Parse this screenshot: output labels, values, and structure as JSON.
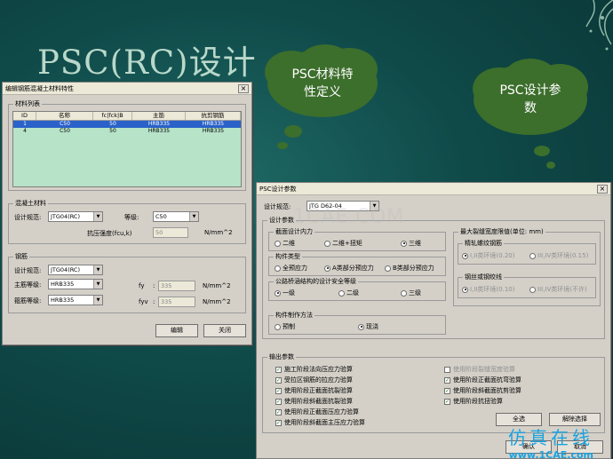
{
  "slide": {
    "title": "PSC(RC)设计"
  },
  "clouds": {
    "material": [
      "PSC材料特",
      "性定义"
    ],
    "design": [
      "PSC设计参",
      "数"
    ]
  },
  "material_dialog": {
    "title": "编辑钢筋混凝土材料特性",
    "close": "×",
    "list_group": "材料列表",
    "columns": [
      "ID",
      "名称",
      "fc|fck|B",
      "主筋",
      "抗剪钢筋"
    ],
    "rows": [
      [
        "1",
        "C50",
        "50",
        "HRB335",
        "HRB335"
      ],
      [
        "4",
        "C50",
        "50",
        "HRB335",
        "HRB335"
      ]
    ],
    "concrete_group": "混凝土材料",
    "design_code_label": "设计规范:",
    "design_code_value": "JTG04(RC)",
    "grade_label": "等级:",
    "grade_value": "C50",
    "strength_label": "抗压强度(fcu,k)",
    "strength_value": "50",
    "strength_unit": "N/mm^2",
    "rebar_group": "钢筋",
    "rebar_code_label": "设计规范:",
    "rebar_code_value": "JTG04(RC)",
    "main_label": "主筋等级:",
    "main_value": "HRB335",
    "stirrup_label": "箍筋等级:",
    "stirrup_value": "HRB335",
    "fy_label": "fy",
    "fy_value": "335",
    "fy_unit": "N/mm^2",
    "fyv_label": "fyv",
    "fyv_value": "335",
    "fyv_unit": "N/mm^2",
    "edit_btn": "编辑",
    "close_btn": "关闭"
  },
  "design_dialog": {
    "title": "PSC设计参数",
    "close": "×",
    "code_label": "设计规范:",
    "code_value": "JTG D62-04",
    "design_params": "设计参数",
    "internal_force": "截面设计内力",
    "force_opts": [
      "二维",
      "二维+扭矩",
      "三维"
    ],
    "member_type": "构件类型",
    "type_opts": [
      "全预应力",
      "A类部分预应力",
      "B类部分预应力"
    ],
    "safety_level": "公路桥涵结构的设计安全等级",
    "safety_opts": [
      "一级",
      "二级",
      "三级"
    ],
    "method": "构件制作方法",
    "method_opts": [
      "预制",
      "现浇"
    ],
    "crack_group": "最大裂缝宽度限值(单位: mm)",
    "rebar_group": "精轧螺纹钢筋",
    "rebar_opts": [
      "I,II类环境(0.20)",
      "III,IV类环境(0.15)"
    ],
    "strand_group": "钢丝或钢绞线",
    "strand_opts": [
      "I,II类环境(0.10)",
      "III,IV类环境(不许)"
    ],
    "output_group": "输出参数",
    "left_checks": [
      "施工阶段法向压应力验算",
      "受拉区钢筋的拉应力验算",
      "使用阶段正截面抗裂验算",
      "使用阶段斜截面抗裂验算",
      "使用阶段正截面压应力验算",
      "使用阶段斜截面主压应力验算"
    ],
    "right_checks": [
      "使用阶段裂缝宽度验算",
      "使用阶段正截面抗弯验算",
      "使用阶段斜截面抗剪验算",
      "使用阶段抗扭验算"
    ],
    "select_all": "全选",
    "deselect": "解除选择",
    "ok": "确认",
    "cancel": "取消"
  },
  "watermark": "1CAE.COM",
  "brand": {
    "cn": "仿真在线",
    "url": "www.1CAE.com"
  },
  "colors": {
    "background": "#0f4a49",
    "title": "#b9d8c9",
    "selection": "#2a62c9",
    "table": "#b7e3c8",
    "brand": "#1aa3e0"
  }
}
